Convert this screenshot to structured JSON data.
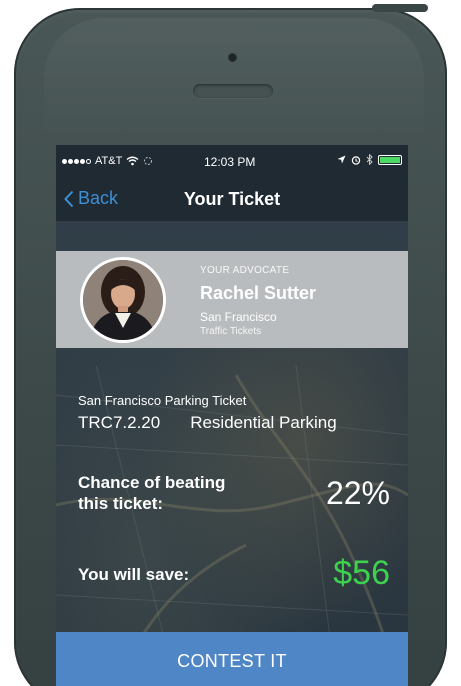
{
  "status_bar": {
    "carrier": "AT&T",
    "time": "12:03 PM",
    "icons": [
      "signal-dots-icon",
      "wifi-icon",
      "activity-spinner-icon",
      "location-arrow-icon",
      "alarm-icon",
      "bluetooth-icon",
      "battery-icon"
    ],
    "battery_color": "#4cd964"
  },
  "nav": {
    "back_label": "Back",
    "title": "Your Ticket"
  },
  "advocate": {
    "kicker": "YOUR ADVOCATE",
    "name": "Rachel Sutter",
    "city": "San Francisco",
    "specialty": "Traffic Tickets"
  },
  "ticket": {
    "type": "San Francisco Parking Ticket",
    "code": "TRC7.2.20",
    "violation": "Residential Parking"
  },
  "stats": {
    "chance_label_line1": "Chance of beating",
    "chance_label_line2": "this ticket:",
    "chance_value": "22%",
    "save_label": "You will save:",
    "save_value": "$56",
    "save_color": "#3cd24e"
  },
  "action": {
    "contest_label": "CONTEST IT",
    "color": "#4f86c6"
  }
}
